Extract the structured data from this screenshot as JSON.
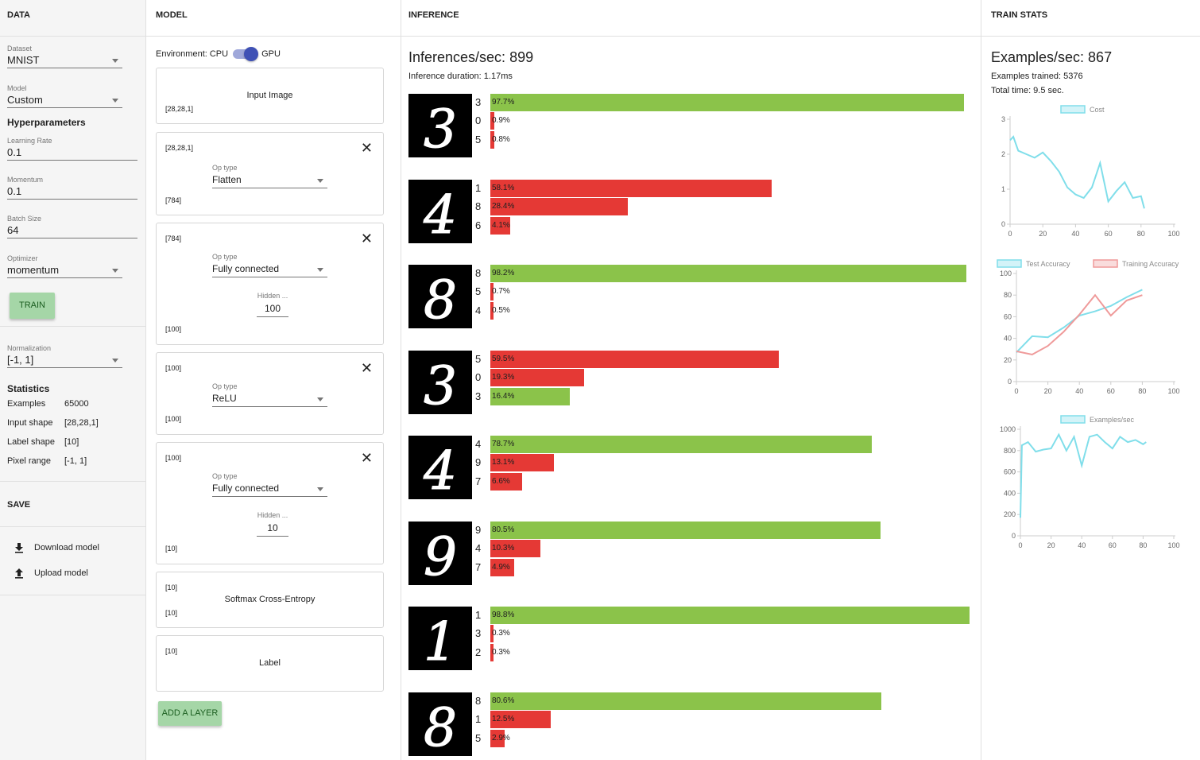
{
  "data_col": {
    "header": "DATA",
    "dataset": {
      "label": "Dataset",
      "value": "MNIST"
    },
    "model": {
      "label": "Model",
      "value": "Custom"
    },
    "hyper_title": "Hyperparameters",
    "learning_rate": {
      "label": "Learning Rate",
      "value": "0.1"
    },
    "momentum": {
      "label": "Momentum",
      "value": "0.1"
    },
    "batch_size": {
      "label": "Batch Size",
      "value": "64"
    },
    "optimizer": {
      "label": "Optimizer",
      "value": "momentum"
    },
    "train_label": "TRAIN",
    "normalization": {
      "label": "Normalization",
      "value": "[-1, 1]"
    },
    "stats_title": "Statistics",
    "stats": [
      {
        "k": "Examples",
        "v": "65000"
      },
      {
        "k": "Input shape",
        "v": "[28,28,1]"
      },
      {
        "k": "Label shape",
        "v": "[10]"
      },
      {
        "k": "Pixel range",
        "v": "[-1, 1]"
      }
    ],
    "save_title": "SAVE",
    "download_label": "Download model",
    "upload_label": "Upload model"
  },
  "model_col": {
    "header": "MODEL",
    "env_label": "Environment: CPU",
    "env_gpu": "GPU",
    "input": {
      "title": "Input Image",
      "shape": "[28,28,1]"
    },
    "layers": [
      {
        "in": "[28,28,1]",
        "op_label": "Op type",
        "op": "Flatten",
        "out": "[784]"
      },
      {
        "in": "[784]",
        "op_label": "Op type",
        "op": "Fully connected",
        "hidden_label": "Hidden ...",
        "hidden": "100",
        "out": "[100]"
      },
      {
        "in": "[100]",
        "op_label": "Op type",
        "op": "ReLU",
        "out": "[100]"
      },
      {
        "in": "[100]",
        "op_label": "Op type",
        "op": "Fully connected",
        "hidden_label": "Hidden ...",
        "hidden": "10",
        "out": "[10]"
      }
    ],
    "loss": {
      "in": "[10]",
      "title": "Softmax Cross-Entropy",
      "out": "[10]"
    },
    "label_card": {
      "in": "[10]",
      "title": "Label"
    },
    "add_layer": "ADD A LAYER"
  },
  "inference": {
    "header": "INFERENCE",
    "rate": "Inferences/sec: 899",
    "duration": "Inference duration: 1.17ms",
    "samples": [
      {
        "digit": "3",
        "preds": [
          {
            "c": "3",
            "p": "97.7%",
            "v": 97.7,
            "ok": true
          },
          {
            "c": "0",
            "p": "0.9%",
            "v": 0.9,
            "ok": false
          },
          {
            "c": "5",
            "p": "0.8%",
            "v": 0.8,
            "ok": false
          }
        ]
      },
      {
        "digit": "4",
        "preds": [
          {
            "c": "1",
            "p": "58.1%",
            "v": 58.1,
            "ok": false
          },
          {
            "c": "8",
            "p": "28.4%",
            "v": 28.4,
            "ok": false
          },
          {
            "c": "6",
            "p": "4.1%",
            "v": 4.1,
            "ok": false
          }
        ]
      },
      {
        "digit": "8",
        "preds": [
          {
            "c": "8",
            "p": "98.2%",
            "v": 98.2,
            "ok": true
          },
          {
            "c": "5",
            "p": "0.7%",
            "v": 0.7,
            "ok": false
          },
          {
            "c": "4",
            "p": "0.5%",
            "v": 0.5,
            "ok": false
          }
        ]
      },
      {
        "digit": "3",
        "preds": [
          {
            "c": "5",
            "p": "59.5%",
            "v": 59.5,
            "ok": false
          },
          {
            "c": "0",
            "p": "19.3%",
            "v": 19.3,
            "ok": false
          },
          {
            "c": "3",
            "p": "16.4%",
            "v": 16.4,
            "ok": true
          }
        ]
      },
      {
        "digit": "4",
        "preds": [
          {
            "c": "4",
            "p": "78.7%",
            "v": 78.7,
            "ok": true
          },
          {
            "c": "9",
            "p": "13.1%",
            "v": 13.1,
            "ok": false
          },
          {
            "c": "7",
            "p": "6.6%",
            "v": 6.6,
            "ok": false
          }
        ]
      },
      {
        "digit": "9",
        "preds": [
          {
            "c": "9",
            "p": "80.5%",
            "v": 80.5,
            "ok": true
          },
          {
            "c": "4",
            "p": "10.3%",
            "v": 10.3,
            "ok": false
          },
          {
            "c": "7",
            "p": "4.9%",
            "v": 4.9,
            "ok": false
          }
        ]
      },
      {
        "digit": "1",
        "preds": [
          {
            "c": "1",
            "p": "98.8%",
            "v": 98.8,
            "ok": true
          },
          {
            "c": "3",
            "p": "0.3%",
            "v": 0.3,
            "ok": false
          },
          {
            "c": "2",
            "p": "0.3%",
            "v": 0.3,
            "ok": false
          }
        ]
      },
      {
        "digit": "8",
        "preds": [
          {
            "c": "8",
            "p": "80.6%",
            "v": 80.6,
            "ok": true
          },
          {
            "c": "1",
            "p": "12.5%",
            "v": 12.5,
            "ok": false
          },
          {
            "c": "5",
            "p": "2.9%",
            "v": 2.9,
            "ok": false
          }
        ]
      }
    ],
    "colors": {
      "correct": "#8bc34a",
      "wrong": "#e53935"
    }
  },
  "train_stats": {
    "header": "TRAIN STATS",
    "rate": "Examples/sec: 867",
    "trained": "Examples trained: 5376",
    "time": "Total time: 9.5 sec."
  },
  "chart_data": [
    {
      "type": "line",
      "series": [
        {
          "name": "Cost",
          "color": "#80deea",
          "x": [
            0,
            2,
            5,
            10,
            15,
            20,
            25,
            30,
            35,
            40,
            45,
            50,
            55,
            60,
            65,
            70,
            75,
            80,
            82
          ],
          "values": [
            2.4,
            2.5,
            2.1,
            2.0,
            1.9,
            2.05,
            1.8,
            1.5,
            1.05,
            0.85,
            0.75,
            1.05,
            1.75,
            0.65,
            0.95,
            1.2,
            0.75,
            0.8,
            0.45
          ]
        }
      ],
      "xlim": [
        0,
        100
      ],
      "ylim": [
        0,
        3
      ],
      "xticks": [
        "0",
        "20",
        "40",
        "60",
        "80",
        "100"
      ],
      "yticks": [
        "0",
        "1",
        "2",
        "3"
      ],
      "legend": "top"
    },
    {
      "type": "line",
      "series": [
        {
          "name": "Test Accuracy",
          "color": "#80deea",
          "x": [
            0,
            10,
            20,
            30,
            40,
            50,
            60,
            70,
            80
          ],
          "values": [
            27,
            42,
            41,
            50,
            61,
            65,
            70,
            78,
            85
          ]
        },
        {
          "name": "Training Accuracy",
          "color": "#ef9a9a",
          "x": [
            0,
            10,
            20,
            30,
            40,
            50,
            60,
            70,
            80
          ],
          "values": [
            28,
            25,
            33,
            46,
            62,
            80,
            61,
            75,
            80
          ]
        }
      ],
      "xlim": [
        0,
        100
      ],
      "ylim": [
        0,
        100
      ],
      "xticks": [
        "0",
        "20",
        "40",
        "60",
        "80",
        "100"
      ],
      "yticks": [
        "0",
        "20",
        "40",
        "60",
        "80",
        "100"
      ],
      "legend": "top"
    },
    {
      "type": "line",
      "series": [
        {
          "name": "Examples/sec",
          "color": "#80deea",
          "x": [
            0,
            1,
            5,
            10,
            15,
            20,
            25,
            30,
            35,
            40,
            45,
            50,
            55,
            60,
            65,
            70,
            75,
            80,
            82
          ],
          "values": [
            170,
            850,
            880,
            790,
            810,
            820,
            950,
            800,
            930,
            660,
            930,
            950,
            880,
            820,
            930,
            880,
            900,
            860,
            880
          ]
        }
      ],
      "xlim": [
        0,
        100
      ],
      "ylim": [
        0,
        1000
      ],
      "xticks": [
        "0",
        "20",
        "40",
        "60",
        "80",
        "100"
      ],
      "yticks": [
        "0",
        "200",
        "400",
        "600",
        "800",
        "1000"
      ],
      "legend": "top"
    }
  ]
}
